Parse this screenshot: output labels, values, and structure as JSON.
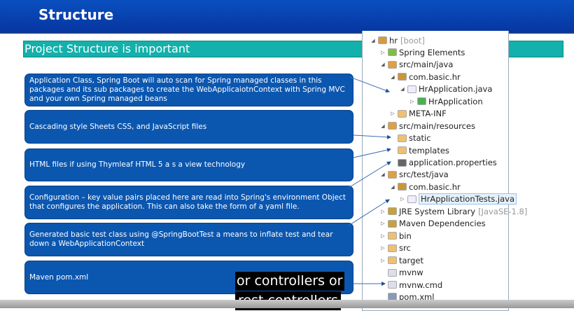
{
  "header": {
    "title": "Structure"
  },
  "subtitle": "Project Structure is important",
  "boxes": [
    "Application Class, Spring Boot will auto scan for Spring managed classes in this packages and its sub packages to create the WebApplicaiotnContext with Spring MVC and your own Spring managed beans",
    "Cascading style Sheets CSS, and JavaScript files",
    "HTML files if using Thymleaf HTML 5 a s a view technology",
    "Configuration – key value pairs placed here are read into Spring's environment Object that configures the application. This can also take the form of a yaml file.",
    "Generated basic test class using @SpringBootTest a means to inflate test and tear down a WebApplicationContext",
    "Maven pom.xml"
  ],
  "tree": [
    {
      "label": "hr",
      "extra": "[boot]"
    },
    {
      "label": "Spring Elements"
    },
    {
      "label": "src/main/java"
    },
    {
      "label": "com.basic.hr"
    },
    {
      "label": "HrApplication.java"
    },
    {
      "label": "HrApplication"
    },
    {
      "label": "META-INF"
    },
    {
      "label": "src/main/resources"
    },
    {
      "label": "static"
    },
    {
      "label": "templates"
    },
    {
      "label": "application.properties"
    },
    {
      "label": "src/test/java"
    },
    {
      "label": "com.basic.hr"
    },
    {
      "label": "HrApplicationTests.java"
    },
    {
      "label": "JRE System Library",
      "extra": "[JavaSE-1.8]"
    },
    {
      "label": "Maven Dependencies"
    },
    {
      "label": "bin"
    },
    {
      "label": "src"
    },
    {
      "label": "target"
    },
    {
      "label": "mvnw"
    },
    {
      "label": "mvnw.cmd"
    },
    {
      "label": "pom.xml"
    }
  ],
  "captions": [
    "or controllers or",
    "rest controllers"
  ]
}
